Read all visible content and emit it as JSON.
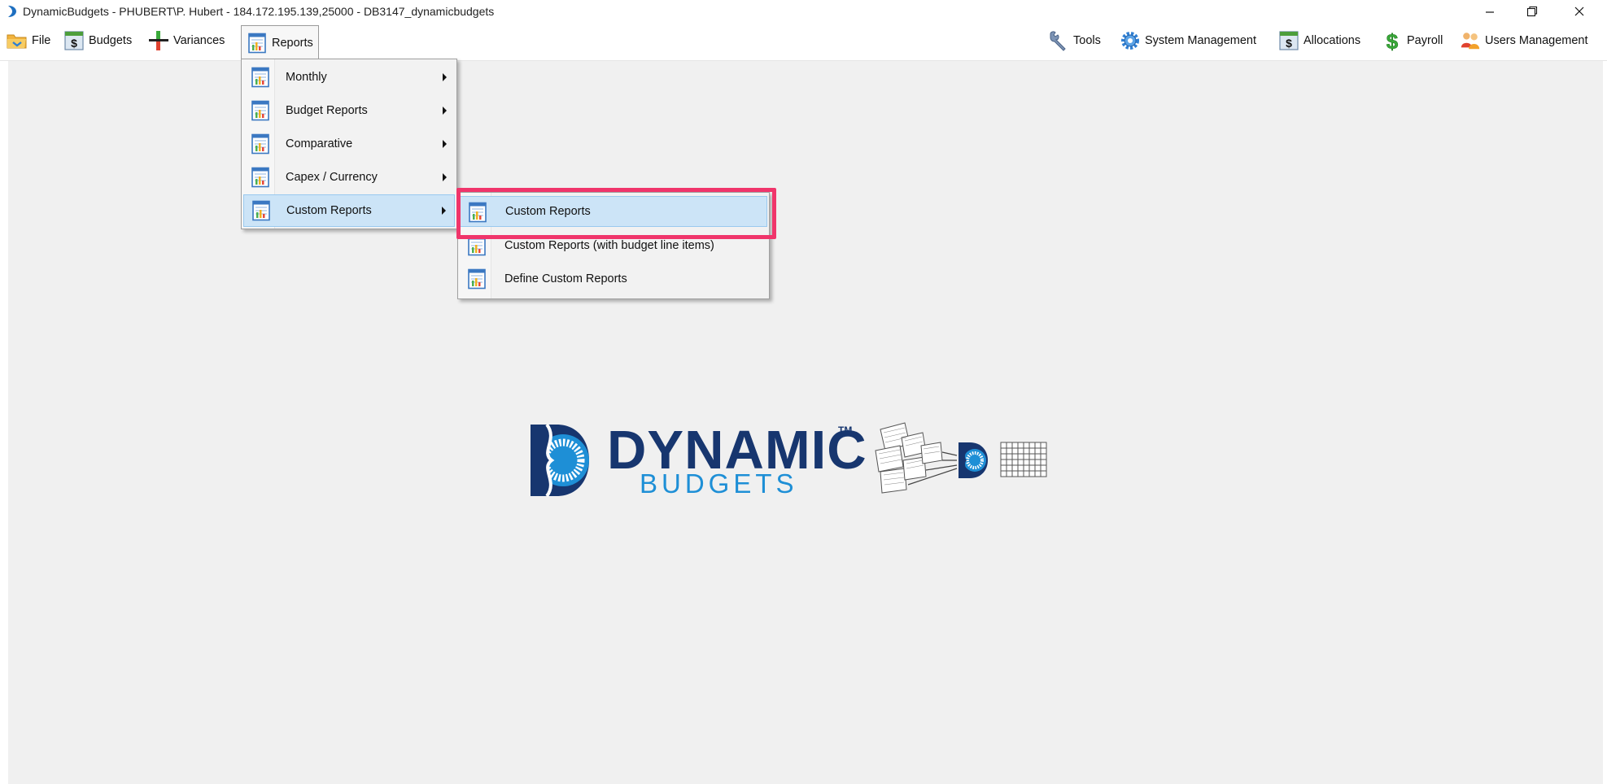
{
  "window": {
    "title": "DynamicBudgets - PHUBERT\\P. Hubert - 184.172.195.139,25000 - DB3147_dynamicbudgets"
  },
  "menubar": {
    "left": [
      {
        "label": "File",
        "icon": "folder-icon"
      },
      {
        "label": "Budgets",
        "icon": "dollar-icon"
      },
      {
        "label": "Variances",
        "icon": "variance-icon"
      },
      {
        "label": "Reports",
        "icon": "report-icon"
      }
    ],
    "right": [
      {
        "label": "Tools",
        "icon": "wrench-icon"
      },
      {
        "label": "System Management",
        "icon": "gear-icon"
      },
      {
        "label": "Allocations",
        "icon": "dollar-icon"
      },
      {
        "label": "Payroll",
        "icon": "payroll-dollar-icon"
      },
      {
        "label": "Users Management",
        "icon": "users-icon"
      }
    ]
  },
  "reports_menu": {
    "items": [
      {
        "label": "Monthly",
        "submenu": true
      },
      {
        "label": "Budget Reports",
        "submenu": true
      },
      {
        "label": "Comparative",
        "submenu": true
      },
      {
        "label": "Capex / Currency",
        "submenu": true
      },
      {
        "label": "Custom Reports",
        "submenu": true,
        "active": true
      }
    ]
  },
  "custom_reports_submenu": {
    "items": [
      {
        "label": "Custom Reports",
        "highlighted": true
      },
      {
        "label": "Custom Reports (with budget line items)"
      },
      {
        "label": "Define Custom Reports"
      }
    ]
  },
  "logo": {
    "word": "DYNAMIC",
    "tm": "TM",
    "sub": "BUDGETS"
  },
  "colors": {
    "highlight_border": "#f0356b",
    "menu_hover": "#cce4f7",
    "logo_navy": "#17366f",
    "logo_blue": "#1e8fd6"
  }
}
